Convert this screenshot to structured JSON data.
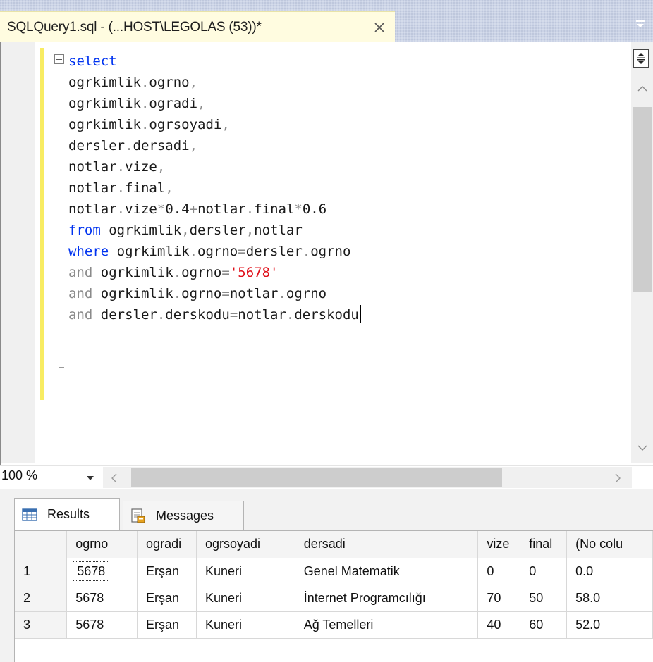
{
  "tab": {
    "title": "SQLQuery1.sql - (...HOST\\LEGOLAS (53))*"
  },
  "editor": {
    "lines": [
      [
        {
          "t": "select",
          "c": "kw"
        }
      ],
      [
        {
          "t": "ogrkimlik",
          "c": ""
        },
        {
          "t": ".",
          "c": "gray"
        },
        {
          "t": "ogrno",
          "c": ""
        },
        {
          "t": ",",
          "c": "gray"
        }
      ],
      [
        {
          "t": "ogrkimlik",
          "c": ""
        },
        {
          "t": ".",
          "c": "gray"
        },
        {
          "t": "ogradi",
          "c": ""
        },
        {
          "t": ",",
          "c": "gray"
        }
      ],
      [
        {
          "t": "ogrkimlik",
          "c": ""
        },
        {
          "t": ".",
          "c": "gray"
        },
        {
          "t": "ogrsoyadi",
          "c": ""
        },
        {
          "t": ",",
          "c": "gray"
        }
      ],
      [
        {
          "t": "dersler",
          "c": ""
        },
        {
          "t": ".",
          "c": "gray"
        },
        {
          "t": "dersadi",
          "c": ""
        },
        {
          "t": ",",
          "c": "gray"
        }
      ],
      [
        {
          "t": "notlar",
          "c": ""
        },
        {
          "t": ".",
          "c": "gray"
        },
        {
          "t": "vize",
          "c": ""
        },
        {
          "t": ",",
          "c": "gray"
        }
      ],
      [
        {
          "t": "notlar",
          "c": ""
        },
        {
          "t": ".",
          "c": "gray"
        },
        {
          "t": "final",
          "c": ""
        },
        {
          "t": ",",
          "c": "gray"
        }
      ],
      [
        {
          "t": "notlar",
          "c": ""
        },
        {
          "t": ".",
          "c": "gray"
        },
        {
          "t": "vize",
          "c": ""
        },
        {
          "t": "*",
          "c": "gray"
        },
        {
          "t": "0.4",
          "c": ""
        },
        {
          "t": "+",
          "c": "gray"
        },
        {
          "t": "notlar",
          "c": ""
        },
        {
          "t": ".",
          "c": "gray"
        },
        {
          "t": "final",
          "c": ""
        },
        {
          "t": "*",
          "c": "gray"
        },
        {
          "t": "0.6",
          "c": ""
        }
      ],
      [
        {
          "t": "from",
          "c": "kw"
        },
        {
          "t": " ogrkimlik",
          "c": ""
        },
        {
          "t": ",",
          "c": "gray"
        },
        {
          "t": "dersler",
          "c": ""
        },
        {
          "t": ",",
          "c": "gray"
        },
        {
          "t": "notlar",
          "c": ""
        }
      ],
      [
        {
          "t": "where",
          "c": "kw"
        },
        {
          "t": " ogrkimlik",
          "c": ""
        },
        {
          "t": ".",
          "c": "gray"
        },
        {
          "t": "ogrno",
          "c": ""
        },
        {
          "t": "=",
          "c": "gray"
        },
        {
          "t": "dersler",
          "c": ""
        },
        {
          "t": ".",
          "c": "gray"
        },
        {
          "t": "ogrno",
          "c": ""
        }
      ],
      [
        {
          "t": "and",
          "c": "gray"
        },
        {
          "t": " ogrkimlik",
          "c": ""
        },
        {
          "t": ".",
          "c": "gray"
        },
        {
          "t": "ogrno",
          "c": ""
        },
        {
          "t": "=",
          "c": "gray"
        },
        {
          "t": "'5678'",
          "c": "str"
        }
      ],
      [
        {
          "t": "and",
          "c": "gray"
        },
        {
          "t": " ogrkimlik",
          "c": ""
        },
        {
          "t": ".",
          "c": "gray"
        },
        {
          "t": "ogrno",
          "c": ""
        },
        {
          "t": "=",
          "c": "gray"
        },
        {
          "t": "notlar",
          "c": ""
        },
        {
          "t": ".",
          "c": "gray"
        },
        {
          "t": "ogrno",
          "c": ""
        }
      ],
      [
        {
          "t": "and",
          "c": "gray"
        },
        {
          "t": " dersler",
          "c": ""
        },
        {
          "t": ".",
          "c": "gray"
        },
        {
          "t": "derskodu",
          "c": ""
        },
        {
          "t": "=",
          "c": "gray"
        },
        {
          "t": "notlar",
          "c": ""
        },
        {
          "t": ".",
          "c": "gray"
        },
        {
          "t": "derskodu",
          "c": ""
        }
      ]
    ]
  },
  "zoom": {
    "value": "100 %"
  },
  "results_tabs": {
    "results_label": "Results",
    "messages_label": "Messages"
  },
  "grid": {
    "columns": [
      "",
      "ogrno",
      "ogradi",
      "ogrsoyadi",
      "dersadi",
      "vize",
      "final",
      "(No colu"
    ],
    "rows": [
      [
        "1",
        "5678",
        "Erşan",
        "Kuneri",
        "Genel Matematik",
        "0",
        "0",
        "0.0"
      ],
      [
        "2",
        "5678",
        "Erşan",
        "Kuneri",
        "İnternet Programcılığı",
        "70",
        "50",
        "58.0"
      ],
      [
        "3",
        "5678",
        "Erşan",
        "Kuneri",
        "Ağ Temelleri",
        "40",
        "60",
        "52.0"
      ]
    ]
  },
  "colors": {
    "keyword": "#0033f0",
    "string": "#e0101a",
    "operator": "#8a8a8a",
    "tab_active": "#fffce0",
    "change_bar": "#f8ec63"
  }
}
